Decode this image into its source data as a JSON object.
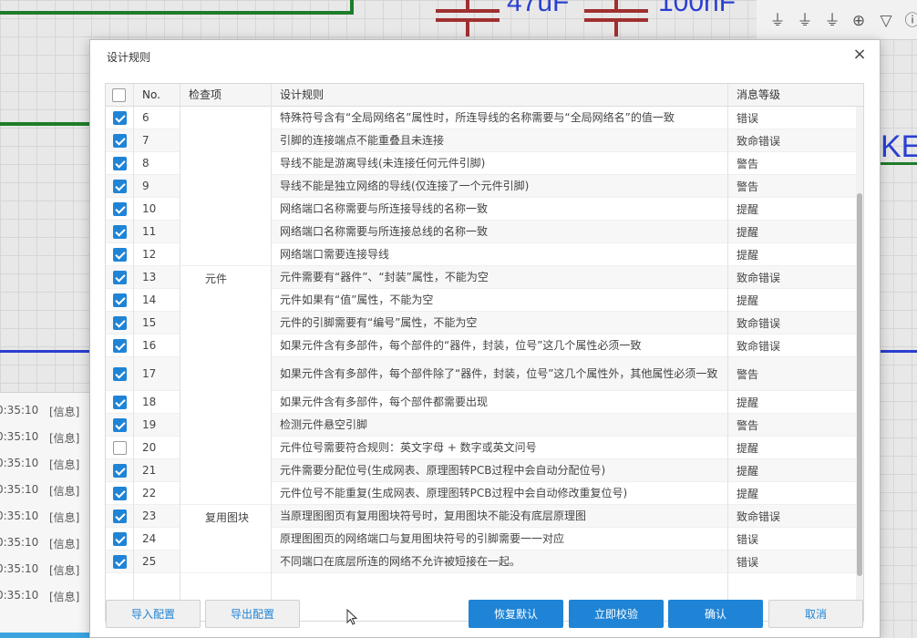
{
  "background": {
    "cap_value_1": "47uF",
    "cap_value_2": "100nF",
    "net_label": "KE",
    "log": [
      {
        "time": "0:35:10",
        "tag": "[信息]"
      },
      {
        "time": "0:35:10",
        "tag": "[信息]"
      },
      {
        "time": "0:35:10",
        "tag": "[信息]"
      },
      {
        "time": "0:35:10",
        "tag": "[信息]"
      },
      {
        "time": "0:35:10",
        "tag": "[信息]"
      },
      {
        "time": "0:35:10",
        "tag": "[信息]"
      },
      {
        "time": "0:35:10",
        "tag": "[信息]"
      },
      {
        "time": "0:35:10",
        "tag": "[信息]"
      }
    ],
    "toolbar_icons": [
      "ground-symbol-icon",
      "ground-symbol-alt-icon",
      "earth-icon",
      "circle-plus-icon",
      "triangle-down-icon",
      "extra-icon"
    ]
  },
  "dialog": {
    "title": "设计规则",
    "close_glyph": "×",
    "columns": {
      "no": "No.",
      "check_item": "检查项",
      "rule": "设计规则",
      "level": "消息等级"
    },
    "groups": [
      {
        "label": "",
        "first_row": 0,
        "last_row": 6
      },
      {
        "label": "元件",
        "first_row": 7,
        "last_row": 16
      },
      {
        "label": "复用图块",
        "first_row": 17,
        "last_row": 19
      }
    ],
    "rows": [
      {
        "no": "6",
        "checked": true,
        "rule": "特殊符号含有“全局网络名”属性时，所连导线的名称需要与“全局网络名”的值一致",
        "level": "错误"
      },
      {
        "no": "7",
        "checked": true,
        "rule": "引脚的连接端点不能重叠且未连接",
        "level": "致命错误"
      },
      {
        "no": "8",
        "checked": true,
        "rule": "导线不能是游离导线(未连接任何元件引脚)",
        "level": "警告"
      },
      {
        "no": "9",
        "checked": true,
        "rule": "导线不能是独立网络的导线(仅连接了一个元件引脚)",
        "level": "警告"
      },
      {
        "no": "10",
        "checked": true,
        "rule": "网络端口名称需要与所连接导线的名称一致",
        "level": "提醒"
      },
      {
        "no": "11",
        "checked": true,
        "rule": "网络端口名称需要与所连接总线的名称一致",
        "level": "提醒"
      },
      {
        "no": "12",
        "checked": true,
        "rule": "网络端口需要连接导线",
        "level": "提醒"
      },
      {
        "no": "13",
        "checked": true,
        "rule": "元件需要有“器件”、“封装”属性，不能为空",
        "level": "致命错误"
      },
      {
        "no": "14",
        "checked": true,
        "rule": "元件如果有“值”属性，不能为空",
        "level": "提醒"
      },
      {
        "no": "15",
        "checked": true,
        "rule": "元件的引脚需要有“编号”属性，不能为空",
        "level": "致命错误"
      },
      {
        "no": "16",
        "checked": true,
        "rule": "如果元件含有多部件，每个部件的“器件，封装，位号”这几个属性必须一致",
        "level": "致命错误"
      },
      {
        "no": "17",
        "checked": true,
        "rule": "如果元件含有多部件，每个部件除了“器件，封装，位号”这几个属性外，其他属性必须一致",
        "level": "警告"
      },
      {
        "no": "18",
        "checked": true,
        "rule": "如果元件含有多部件，每个部件都需要出现",
        "level": "提醒"
      },
      {
        "no": "19",
        "checked": true,
        "rule": "检测元件悬空引脚",
        "level": "警告"
      },
      {
        "no": "20",
        "checked": false,
        "rule": "元件位号需要符合规则：英文字母 + 数字或英文问号",
        "level": "提醒"
      },
      {
        "no": "21",
        "checked": true,
        "rule": "元件需要分配位号(生成网表、原理图转PCB过程中会自动分配位号)",
        "level": "提醒"
      },
      {
        "no": "22",
        "checked": true,
        "rule": "元件位号不能重复(生成网表、原理图转PCB过程中会自动修改重复位号)",
        "level": "提醒"
      },
      {
        "no": "23",
        "checked": true,
        "rule": "当原理图图页有复用图块符号时，复用图块不能没有底层原理图",
        "level": "致命错误"
      },
      {
        "no": "24",
        "checked": true,
        "rule": "原理图图页的网络端口与复用图块符号的引脚需要一一对应",
        "level": "错误"
      },
      {
        "no": "25",
        "checked": true,
        "rule": "不同端口在底层所连的网络不允许被短接在一起。",
        "level": "错误"
      }
    ],
    "buttons": {
      "import": "导入配置",
      "export": "导出配置",
      "restore": "恢复默认",
      "validate": "立即校验",
      "confirm": "确认",
      "cancel": "取消"
    }
  },
  "colors": {
    "accent": "#1f84d6",
    "wire_green": "#1e7d2a",
    "wire_blue": "#2a3fd0",
    "capacitor": "#a03030"
  }
}
